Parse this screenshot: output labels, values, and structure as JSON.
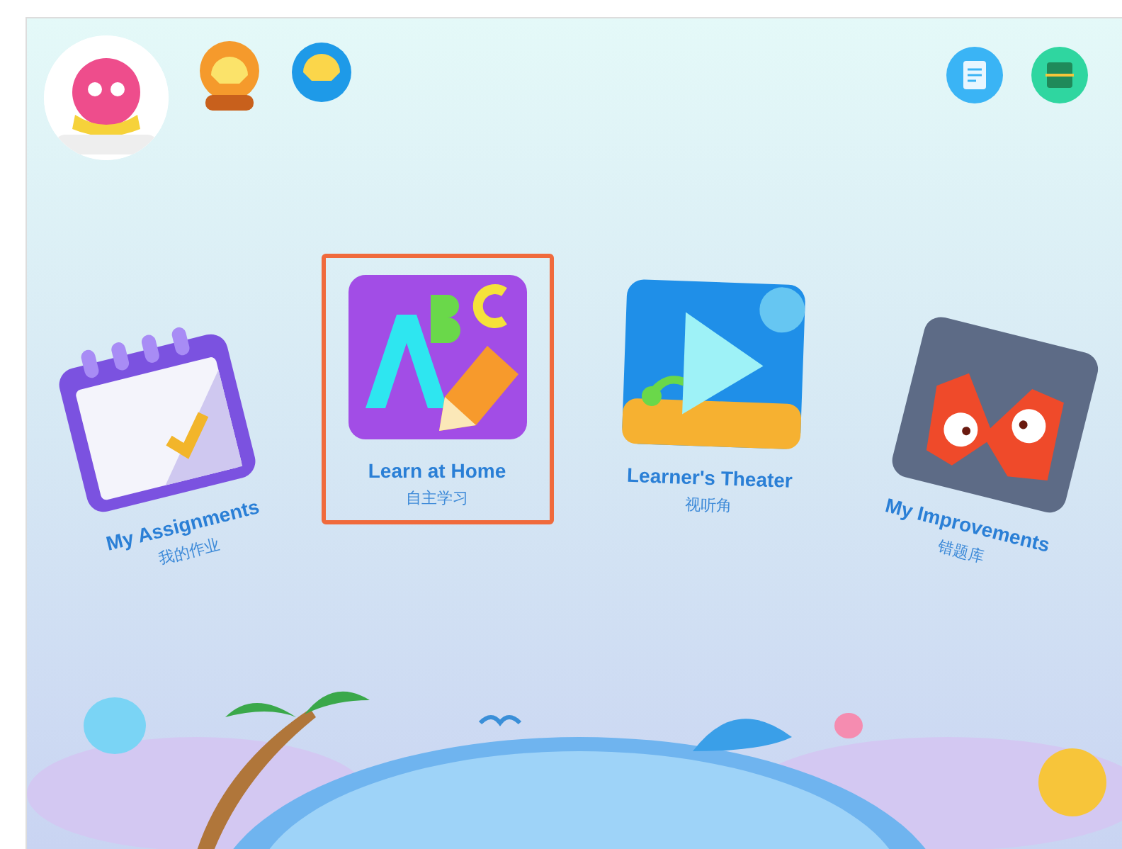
{
  "cards": [
    {
      "kind": "calendar",
      "title": "My Assignments",
      "subtitle": "我的作业",
      "selected": false
    },
    {
      "kind": "abc",
      "title": "Learn at Home",
      "subtitle": "自主学习",
      "selected": true
    },
    {
      "kind": "play",
      "title": "Learner's Theater",
      "subtitle": "视听角",
      "selected": false
    },
    {
      "kind": "monster",
      "title": "My Improvements",
      "subtitle": "错题库",
      "selected": false
    }
  ]
}
